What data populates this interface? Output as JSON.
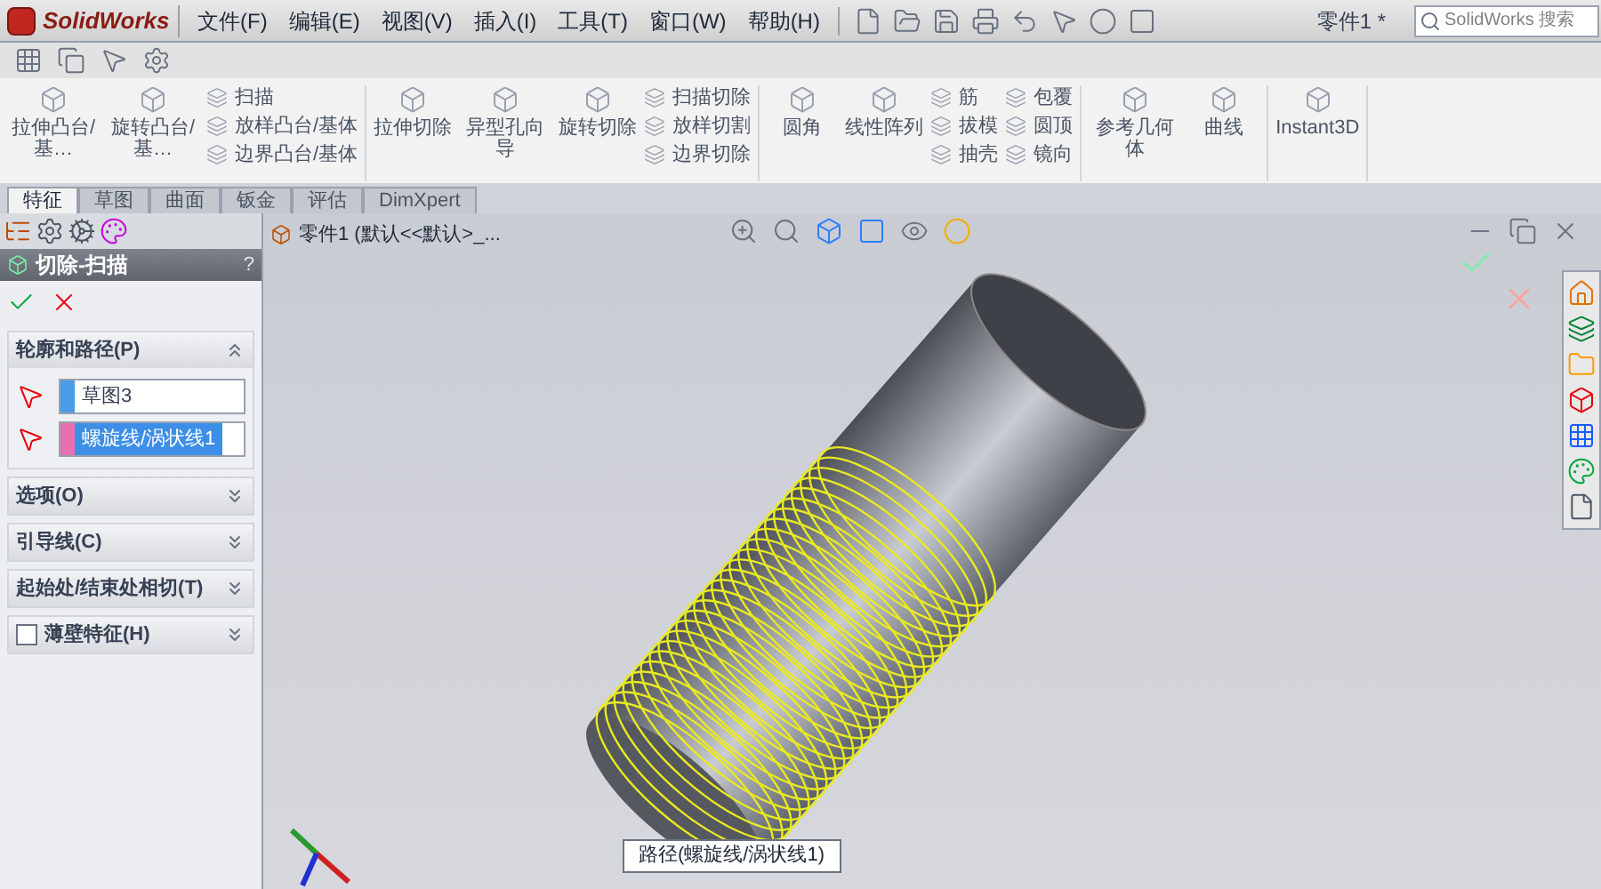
{
  "app": {
    "name": "SolidWorks"
  },
  "menu": [
    "文件(F)",
    "编辑(E)",
    "视图(V)",
    "插入(I)",
    "工具(T)",
    "窗口(W)",
    "帮助(H)"
  ],
  "document_title": "零件1 *",
  "search": {
    "placeholder": "SolidWorks 搜索"
  },
  "ribbon": {
    "groups": [
      {
        "items": [
          {
            "kind": "large",
            "label": "拉伸凸台/基…"
          },
          {
            "kind": "large",
            "label": "旋转凸台/基…"
          },
          {
            "kind": "small",
            "label": "扫描"
          },
          {
            "kind": "small",
            "label": "放样凸台/基体"
          },
          {
            "kind": "small",
            "label": "边界凸台/基体"
          }
        ]
      },
      {
        "items": [
          {
            "kind": "large",
            "label": "拉伸切除"
          },
          {
            "kind": "large",
            "label": "异型孔向导"
          },
          {
            "kind": "large",
            "label": "旋转切除"
          },
          {
            "kind": "small",
            "label": "扫描切除"
          },
          {
            "kind": "small",
            "label": "放样切割"
          },
          {
            "kind": "small",
            "label": "边界切除"
          }
        ]
      },
      {
        "items": [
          {
            "kind": "large",
            "label": "圆角"
          },
          {
            "kind": "large",
            "label": "线性阵列"
          },
          {
            "kind": "small",
            "label": "筋"
          },
          {
            "kind": "small",
            "label": "拔模"
          },
          {
            "kind": "small",
            "label": "抽壳"
          },
          {
            "kind": "small",
            "label": "包覆"
          },
          {
            "kind": "small",
            "label": "圆顶"
          },
          {
            "kind": "small",
            "label": "镜向"
          }
        ]
      },
      {
        "items": [
          {
            "kind": "large",
            "label": "参考几何体"
          },
          {
            "kind": "large",
            "label": "曲线"
          }
        ]
      },
      {
        "items": [
          {
            "kind": "large",
            "label": "Instant3D"
          }
        ]
      }
    ]
  },
  "tabs": [
    {
      "label": "特征",
      "selected": true
    },
    {
      "label": "草图",
      "selected": false
    },
    {
      "label": "曲面",
      "selected": false
    },
    {
      "label": "钣金",
      "selected": false
    },
    {
      "label": "评估",
      "selected": false
    },
    {
      "label": "DimXpert",
      "selected": false
    }
  ],
  "property_manager": {
    "title": "切除-扫描",
    "help": "?",
    "sections": [
      {
        "title": "轮廓和路径(P)",
        "expanded": true,
        "fields": [
          {
            "value": "草图3",
            "color": "#4a9be8",
            "selected": false
          },
          {
            "value": "螺旋线/涡状线1",
            "color": "#e86fb0",
            "selected": true
          }
        ]
      },
      {
        "title": "选项(O)",
        "expanded": false
      },
      {
        "title": "引导线(C)",
        "expanded": false
      },
      {
        "title": "起始处/结束处相切(T)",
        "expanded": false
      },
      {
        "title": "薄壁特征(H)",
        "expanded": false,
        "checked": false
      }
    ]
  },
  "tree": {
    "label": "零件1 (默认<<默认>_..."
  },
  "viewport": {
    "path_label": "路径(螺旋线/涡状线1)"
  }
}
